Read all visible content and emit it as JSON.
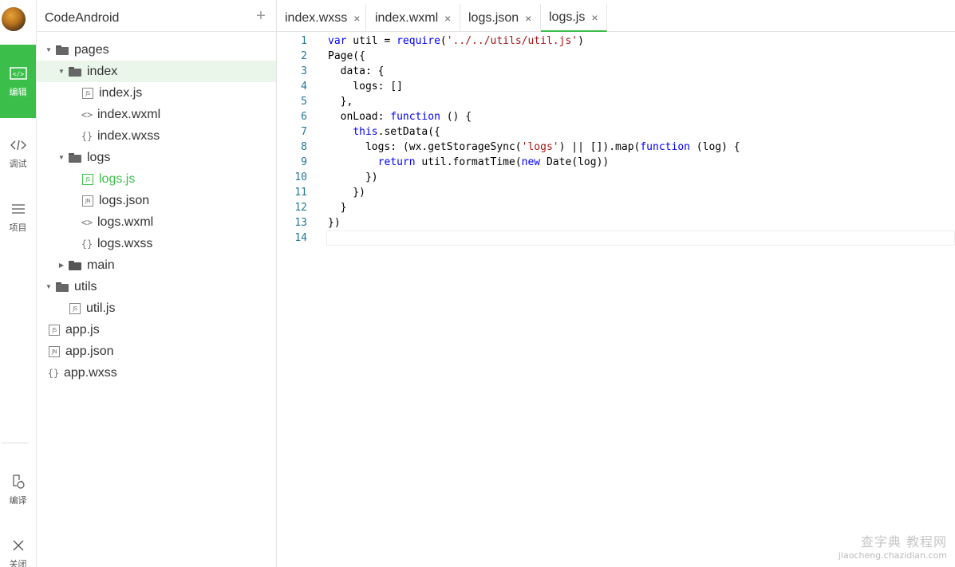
{
  "activity_bar": {
    "edit_label": "编辑",
    "debug_label": "调试",
    "project_label": "项目",
    "compile_label": "编译",
    "close_label": "关闭"
  },
  "tree": {
    "project_name": "CodeAndroid",
    "add_symbol": "+",
    "nodes": [
      {
        "label": "pages"
      },
      {
        "label": "index"
      },
      {
        "label": "index.js",
        "badge": "JS"
      },
      {
        "label": "index.wxml",
        "badge": "<>"
      },
      {
        "label": "index.wxss",
        "badge": "{}"
      },
      {
        "label": "logs"
      },
      {
        "label": "logs.js",
        "badge": "JS"
      },
      {
        "label": "logs.json",
        "badge": "JN"
      },
      {
        "label": "logs.wxml",
        "badge": "<>"
      },
      {
        "label": "logs.wxss",
        "badge": "{}"
      },
      {
        "label": "main"
      },
      {
        "label": "utils"
      },
      {
        "label": "util.js",
        "badge": "JS"
      },
      {
        "label": "app.js",
        "badge": "JS"
      },
      {
        "label": "app.json",
        "badge": "JN"
      },
      {
        "label": "app.wxss",
        "badge": "{}"
      }
    ]
  },
  "tabs": [
    {
      "label": "index.wxss"
    },
    {
      "label": "index.wxml"
    },
    {
      "label": "logs.json"
    },
    {
      "label": "logs.js"
    }
  ],
  "tab_close_symbol": "×",
  "editor": {
    "lines": [
      {
        "n": "1",
        "text": "var util = require('../../utils/util.js')"
      },
      {
        "n": "2",
        "text": "Page({"
      },
      {
        "n": "3",
        "text": "  data: {"
      },
      {
        "n": "4",
        "text": "    logs: []"
      },
      {
        "n": "5",
        "text": "  },"
      },
      {
        "n": "6",
        "text": "  onLoad: function () {"
      },
      {
        "n": "7",
        "text": "    this.setData({"
      },
      {
        "n": "8",
        "text": "      logs: (wx.getStorageSync('logs') || []).map(function (log) {"
      },
      {
        "n": "9",
        "text": "        return util.formatTime(new Date(log))"
      },
      {
        "n": "10",
        "text": "      })"
      },
      {
        "n": "11",
        "text": "    })"
      },
      {
        "n": "12",
        "text": "  }"
      },
      {
        "n": "13",
        "text": "})"
      },
      {
        "n": "14",
        "text": ""
      }
    ]
  },
  "watermark": {
    "line1": "查字典 教程网",
    "line2": "jiaocheng.chazidian.com"
  },
  "colors": {
    "accent": "#3cbf4a",
    "keyword": "#0000ff",
    "string": "#a31515",
    "line_number": "#237893"
  }
}
